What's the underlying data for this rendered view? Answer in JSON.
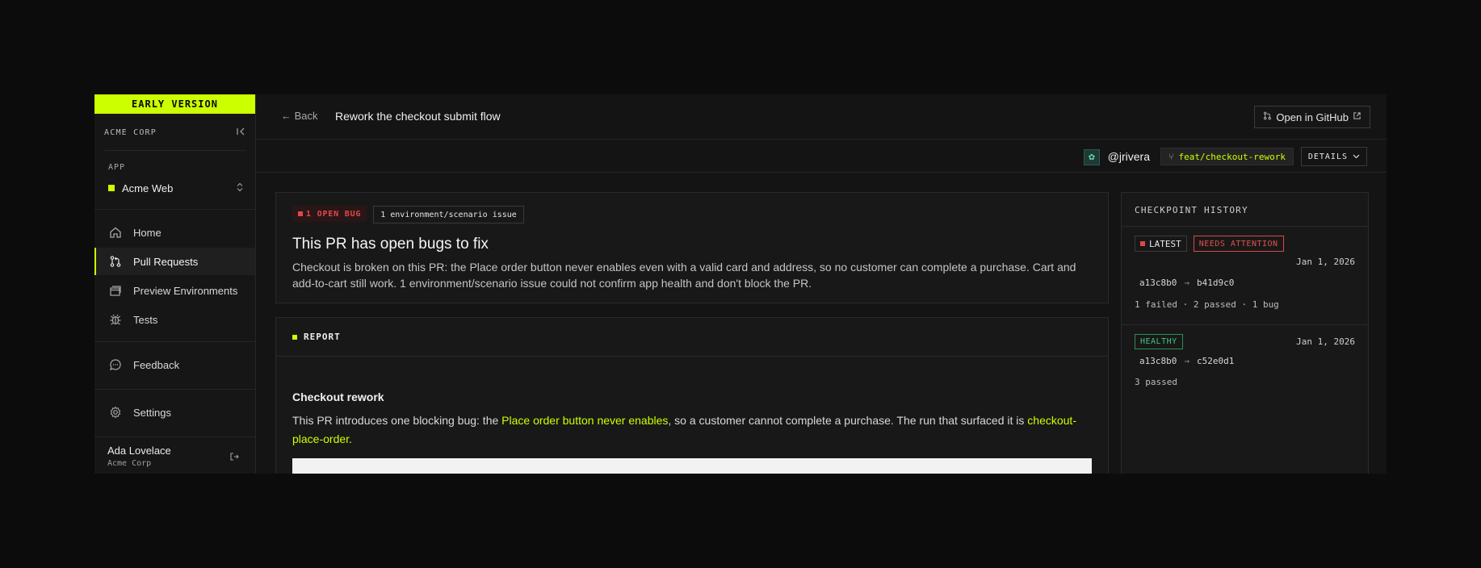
{
  "sidebar": {
    "banner": "EARLY VERSION",
    "org_name": "ACME CORP",
    "app_section_label": "APP",
    "app_name": "Acme Web",
    "nav": [
      {
        "label": "Home",
        "icon": "home-icon"
      },
      {
        "label": "Pull Requests",
        "icon": "pull-request-icon",
        "active": true
      },
      {
        "label": "Preview Environments",
        "icon": "window-stack-icon"
      },
      {
        "label": "Tests",
        "icon": "bug-icon"
      },
      {
        "label": "Feedback",
        "icon": "chat-bubble-icon"
      },
      {
        "label": "Settings",
        "icon": "gear-icon"
      }
    ],
    "user": {
      "name": "Ada Lovelace",
      "org": "Acme Corp"
    }
  },
  "header": {
    "back_label": "Back",
    "title": "Rework the checkout submit flow",
    "github_button": "Open in GitHub"
  },
  "subbar": {
    "author": "@jrivera",
    "branch": "feat/checkout-rework",
    "details_label": "DETAILS"
  },
  "summary": {
    "bug_badge": "1 OPEN BUG",
    "env_badge": "1 environment/scenario issue",
    "title": "This PR has open bugs to fix",
    "description": "Checkout is broken on this PR: the Place order button never enables even with a valid card and address, so no customer can complete a purchase. Cart and add-to-cart still work. 1 environment/scenario issue could not confirm app health and don't block the PR."
  },
  "report": {
    "section_label": "REPORT",
    "title": "Checkout rework",
    "body_prefix": "This PR introduces one blocking bug: the ",
    "body_link": "Place order button never enables",
    "body_middle": ", so a customer cannot complete a purchase. The run that surfaced it is ",
    "body_run_link": "checkout-place-order",
    "body_suffix": "."
  },
  "checkpoints": {
    "title": "CHECKPOINT HISTORY",
    "entries": [
      {
        "badges": [
          "LATEST",
          "NEEDS ATTENTION"
        ],
        "date": "Jan 1, 2026",
        "from": "a13c8b0",
        "to": "b41d9c0",
        "summary": "1 failed · 2 passed · 1 bug"
      },
      {
        "badges": [
          "HEALTHY"
        ],
        "date": "Jan 1, 2026",
        "from": "a13c8b0",
        "to": "c52e0d1",
        "summary": "3 passed"
      }
    ]
  },
  "colors": {
    "accent": "#ccff00",
    "danger": "#e04848",
    "healthy": "#41c47a",
    "background": "#141414"
  }
}
